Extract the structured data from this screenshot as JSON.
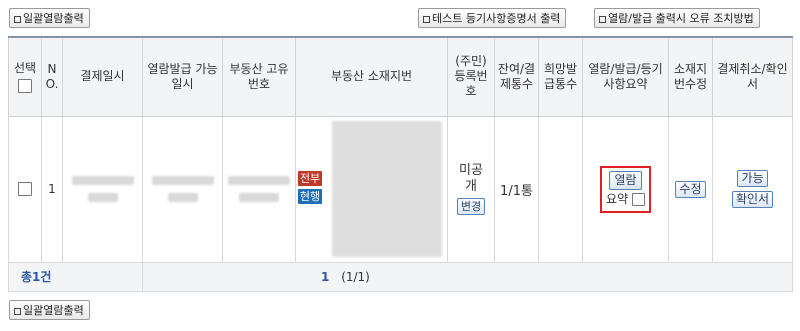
{
  "toolbar": {
    "bulk_print": "일괄열람출력",
    "test_print": "테스트 등기사항증명서 출력",
    "error_help": "열람/발급 출력시 오류 조치방법"
  },
  "table": {
    "headers": {
      "select": "선택",
      "no": "N O.",
      "pay_date": "결제일시",
      "available": "열람발급 가능일시",
      "realty_no": "부동산 고유번호",
      "address": "부동산 소재지번",
      "reg_no": "(주민)등록번호",
      "remain": "잔여/결제통수",
      "wanted": "희망발급통수",
      "summary": "열람/발급/등기사항요약",
      "addr_fix": "소재지번수정",
      "cancel": "결제취소/확인서"
    },
    "row": {
      "no": "1",
      "badge_all": "전부",
      "badge_current": "현행",
      "reg_no_status": "미공개",
      "change_button": "변경",
      "remain": "1/1통",
      "view_button": "열람",
      "summary_label": "요약",
      "fix_button": "수정",
      "cancel_button": "가능",
      "certificate_button": "확인서"
    },
    "footer": {
      "total": "총1건",
      "current_page": "1",
      "page_info": "(1/1)"
    }
  },
  "colors": {
    "badge_all": "#c0392b",
    "badge_current": "#1f6fb8",
    "highlight": "#e02020",
    "total_text": "#2b58a6"
  }
}
